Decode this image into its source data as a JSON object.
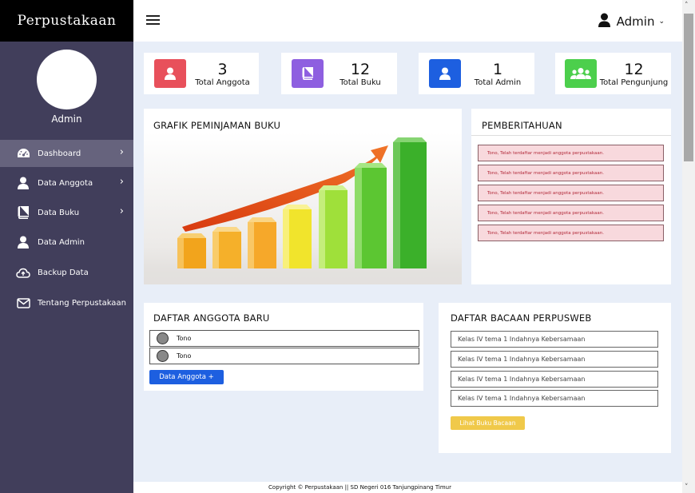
{
  "app": {
    "brand": "Perpustakaan"
  },
  "sidebar": {
    "user_name": "Admin",
    "items": [
      {
        "label": "Dashboard",
        "icon": "dashboard-icon",
        "active": true,
        "has_children": true
      },
      {
        "label": "Data Anggota",
        "icon": "user-icon",
        "has_children": true
      },
      {
        "label": "Data Buku",
        "icon": "book-icon",
        "has_children": true
      },
      {
        "label": "Data Admin",
        "icon": "user-icon",
        "has_children": false
      },
      {
        "label": "Backup Data",
        "icon": "cloud-upload-icon",
        "has_children": false
      },
      {
        "label": "Tentang Perpustakaan",
        "icon": "envelope-icon",
        "has_children": false
      }
    ]
  },
  "header": {
    "user_label": "Admin"
  },
  "stats": [
    {
      "value": "3",
      "label": "Total Anggota",
      "color": "#e8505b",
      "icon": "user-icon"
    },
    {
      "value": "12",
      "label": "Total Buku",
      "color": "#8e5fe0",
      "icon": "book-icon"
    },
    {
      "value": "1",
      "label": "Total Admin",
      "color": "#1d5fe0",
      "icon": "user-icon"
    },
    {
      "value": "12",
      "label": "Total Pengunjung",
      "color": "#4ccf4c",
      "icon": "group-icon"
    }
  ],
  "chart_panel": {
    "title": "GRAFIK PEMINJAMAN BUKU"
  },
  "notifications": {
    "title": "PEMBERITAHUAN",
    "items": [
      "Tono, Telah terdaftar menjadi anggota perpustakaan.",
      "Tono, Telah terdaftar menjadi anggota perpustakaan.",
      "Tono, Telah terdaftar menjadi anggota perpustakaan.",
      "Tono, Telah terdaftar menjadi anggota perpustakaan.",
      "Tono, Telah terdaftar menjadi anggota perpustakaan."
    ]
  },
  "new_members": {
    "title": "DAFTAR ANGGOTA BARU",
    "items": [
      "Tono",
      "Tono"
    ],
    "button_label": "Data Anggota +"
  },
  "reading_list": {
    "title": "DAFTAR BACAAN PERPUSWEB",
    "items": [
      "Kelas IV tema 1 Indahnya Kebersamaan",
      "Kelas IV tema 1 Indahnya Kebersamaan",
      "Kelas IV tema 1 Indahnya Kebersamaan",
      "Kelas IV tema 1 Indahnya Kebersamaan"
    ],
    "button_label": "Lihat Buku Bacaan"
  },
  "footer": {
    "text": "Copyright © Perpustakaan || SD Negeri 016 Tanjungpinang Timur"
  }
}
